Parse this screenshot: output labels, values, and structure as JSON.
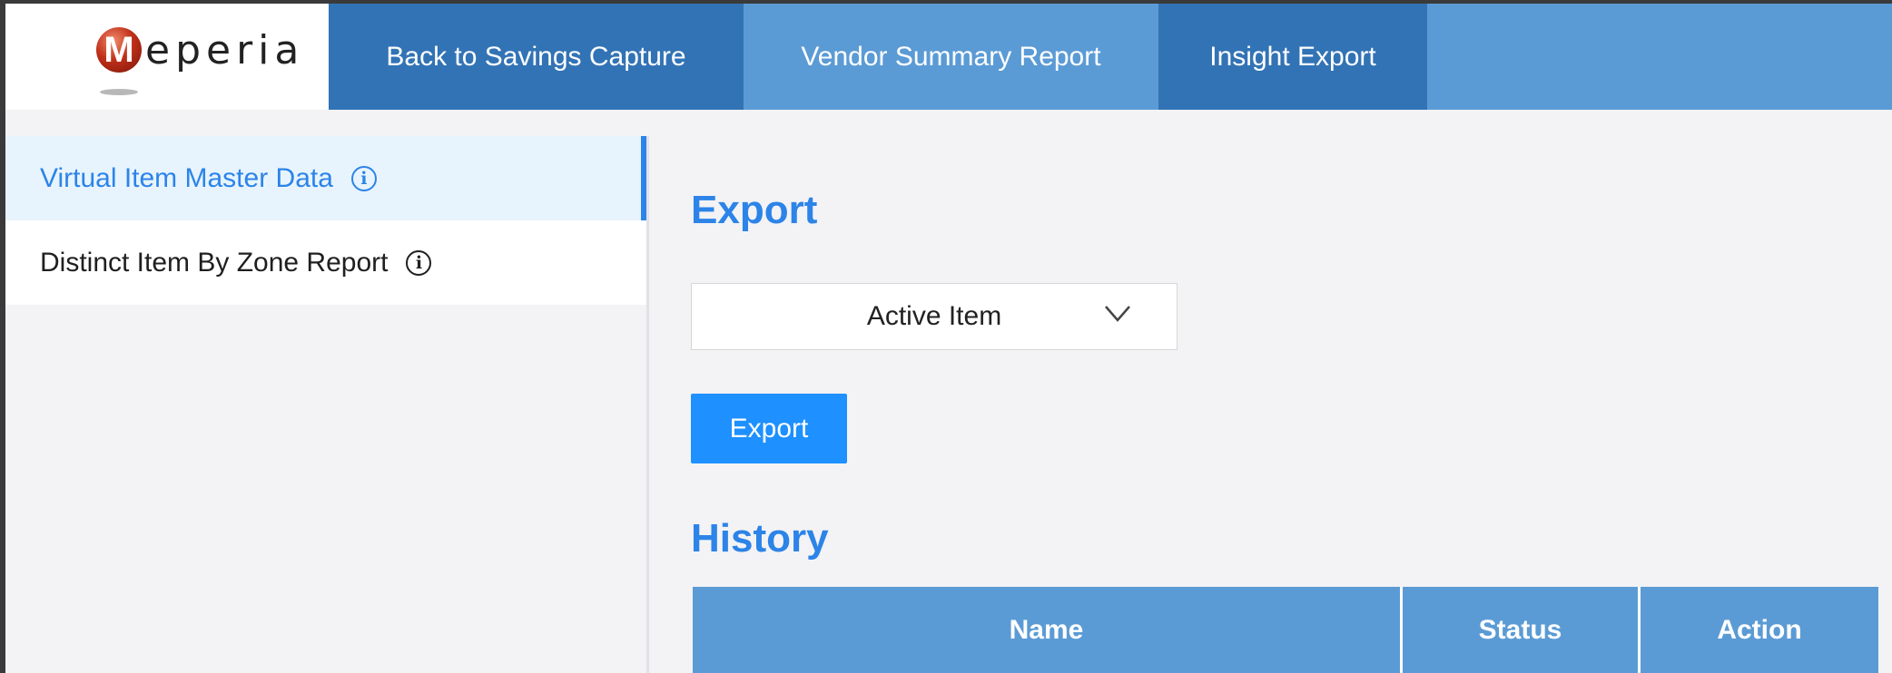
{
  "app": {
    "logo_text": "eperia",
    "logo_letter": "M",
    "colors": {
      "primary": "#2c84e8",
      "nav": "#5b9bd5",
      "nav_dark": "#3273b5",
      "button": "#1e90ff"
    }
  },
  "nav": {
    "tabs": [
      {
        "label": "Back to Savings Capture"
      },
      {
        "label": "Vendor Summary Report"
      },
      {
        "label": "Insight Export"
      }
    ]
  },
  "sidebar": {
    "items": [
      {
        "label": "Virtual Item Master Data",
        "icon": "info-icon",
        "active": true
      },
      {
        "label": "Distinct Item By Zone Report",
        "icon": "info-icon",
        "active": false
      }
    ]
  },
  "main": {
    "export_title": "Export",
    "select": {
      "value": "Active Item",
      "icon": "chevron-down-icon"
    },
    "export_button": "Export",
    "history_title": "History",
    "table": {
      "columns": [
        "Name",
        "Status",
        "Action"
      ],
      "rows": []
    }
  }
}
